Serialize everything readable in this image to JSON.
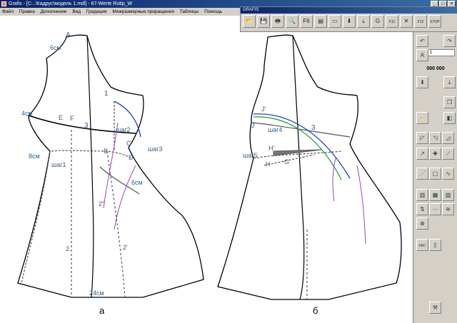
{
  "window": {
    "title": "Grafis - [C:..\\Кадрус\\модель 1.mdl] - 67-Werte Rutip_W",
    "controls": [
      "_",
      "□",
      "×"
    ]
  },
  "menu": [
    "Файл",
    "Правка",
    "Дополнение",
    "Вид",
    "Градация",
    "Межразмерные приращения",
    "Таблицы",
    "Помощь"
  ],
  "toolbar": {
    "title": "GRAFIS",
    "buttons": [
      {
        "name": "open-folder-icon",
        "glyph": "📂"
      },
      {
        "name": "save-icon",
        "glyph": "💾"
      },
      {
        "name": "print-icon",
        "glyph": "🖶"
      },
      {
        "name": "zoom-icon",
        "glyph": "🔍"
      },
      {
        "name": "f6-icon",
        "glyph": "F6"
      },
      {
        "name": "document-icon",
        "glyph": "▤"
      },
      {
        "name": "ruler-icon",
        "glyph": "▭"
      },
      {
        "name": "arrow-down-icon",
        "glyph": "⬇"
      },
      {
        "name": "arrow-down-bar-icon",
        "glyph": "⤓"
      },
      {
        "name": "g-icon",
        "glyph": "G"
      },
      {
        "name": "f11-icon",
        "glyph": "F11"
      },
      {
        "name": "delete-x-icon",
        "glyph": "✕"
      },
      {
        "name": "f12-icon",
        "glyph": "F12"
      },
      {
        "name": "stop-icon",
        "glyph": "STOP"
      }
    ]
  },
  "right_panel": {
    "field_value": "1",
    "coords": "000 000",
    "buttons": [
      {
        "name": "undo-icon",
        "glyph": "↶"
      },
      {
        "name": "redo-icon",
        "glyph": "↷"
      },
      {
        "name": "abc-icon",
        "glyph": "A"
      },
      {
        "name": "down-arrow-icon",
        "glyph": "⬇"
      },
      {
        "name": "down-arrow-2-icon",
        "glyph": "⤓"
      },
      {
        "name": "copy-icon",
        "glyph": "❐"
      },
      {
        "name": "open-icon",
        "glyph": "📂"
      },
      {
        "name": "piece-icon",
        "glyph": "◧"
      },
      {
        "name": "shape-1-icon",
        "glyph": "◸"
      },
      {
        "name": "shape-2-icon",
        "glyph": "◹"
      },
      {
        "name": "shape-3-icon",
        "glyph": "◿"
      },
      {
        "name": "line-1-icon",
        "glyph": "↗"
      },
      {
        "name": "cross-icon",
        "glyph": "✚"
      },
      {
        "name": "line-2-icon",
        "glyph": "⟋"
      },
      {
        "name": "points-icon",
        "glyph": "⋰"
      },
      {
        "name": "square-icon",
        "glyph": "▢"
      },
      {
        "name": "curve-icon",
        "glyph": "∿"
      },
      {
        "name": "piece-a-icon",
        "glyph": "▥"
      },
      {
        "name": "piece-b-icon",
        "glyph": "▦"
      },
      {
        "name": "piece-c-icon",
        "glyph": "▧"
      },
      {
        "name": "measure-1-icon",
        "glyph": "⇅"
      },
      {
        "name": "measure-2-icon",
        "glyph": "⋯"
      },
      {
        "name": "measure-3-icon",
        "glyph": "≋"
      },
      {
        "name": "target-icon",
        "glyph": "⊗"
      },
      {
        "name": "abc-check-icon",
        "glyph": "ABC"
      },
      {
        "name": "page-icon",
        "glyph": "▯"
      },
      {
        "name": "tool-icon",
        "glyph": "⚒"
      }
    ]
  },
  "drawing": {
    "labels_a": {
      "A": "A",
      "sm6": "6см",
      "sm4": "4см",
      "E": "E",
      "F": "F",
      "n3": "3",
      "n1": "1",
      "shag2": "шаг2",
      "C": "C",
      "B": "B",
      "shag3": "шаг3",
      "D": "D",
      "sm8": "8см",
      "shag1": "шаг1",
      "sm6b": "6см",
      "n2pp": "2\"",
      "n2": "2",
      "n2p": "2'",
      "sm24": "24см"
    },
    "labels_b": {
      "Jp": "J'",
      "J": "J",
      "shag4": "шаг4",
      "n3": "3",
      "Hp": "H'",
      "shag5": "шаг5",
      "H": "H",
      "G": "G"
    },
    "caption_a": "а",
    "caption_b": "б",
    "colors": {
      "label": "#2e5f8a",
      "blue": "#1f3fc0",
      "purple": "#a040c0",
      "green": "#2a9a3a",
      "line": "#000"
    }
  }
}
